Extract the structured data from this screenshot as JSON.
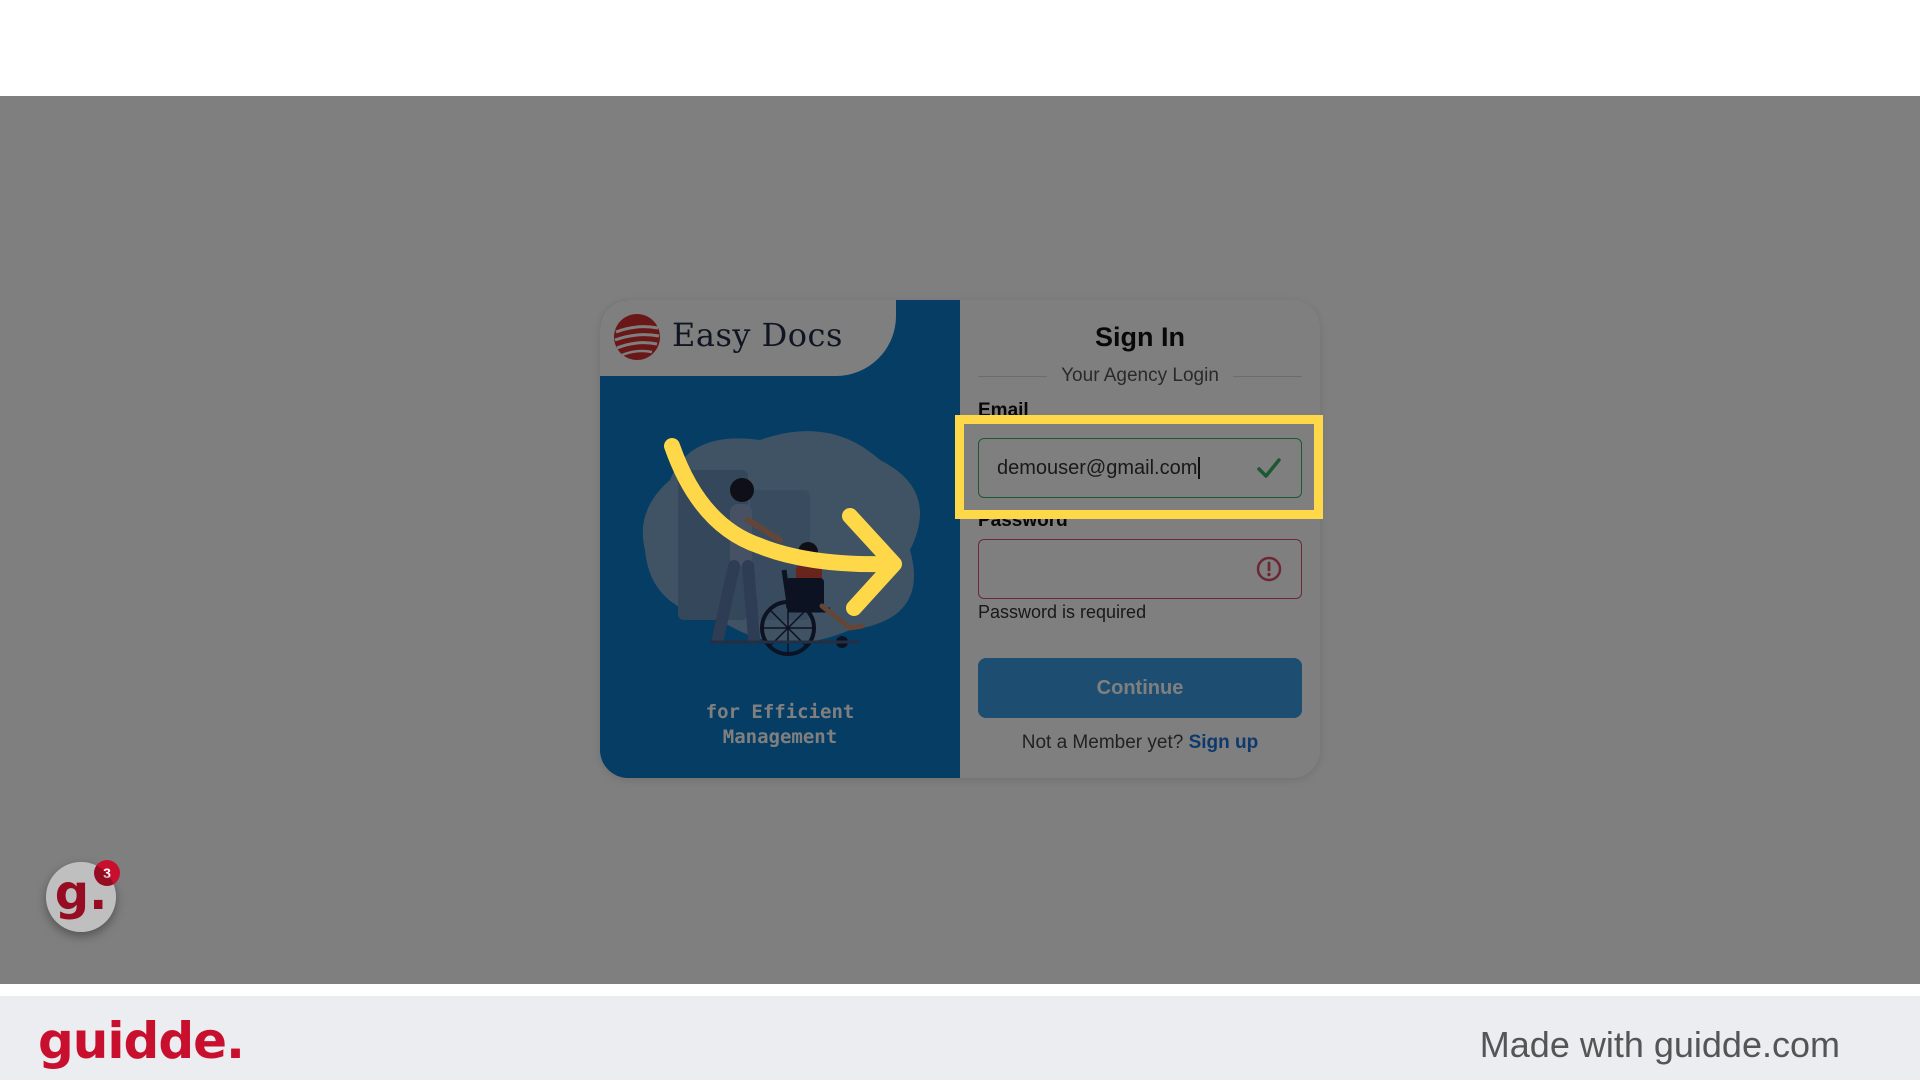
{
  "app": {
    "logo_text": "Easy Docs",
    "tagline_line1": "for Efficient",
    "tagline_line2": "Management",
    "colors": {
      "panel_blue": "#0a7ac9",
      "accent_yellow": "#ffd84a",
      "brand_red": "#c8102e",
      "valid_green": "#39b265",
      "error_red": "#d94f6a"
    }
  },
  "signin": {
    "title": "Sign In",
    "subtitle": "Your Agency Login",
    "email_label": "Email",
    "email_value": "demouser@gmail.com",
    "password_label": "Password",
    "password_value": "",
    "password_error": "Password is required",
    "continue_label": "Continue",
    "member_prompt": "Not a Member yet?",
    "signup_label": "Sign up",
    "email_status_icon": "check-icon",
    "password_status_icon": "error-circle-icon"
  },
  "guide": {
    "bubble_letter": "g.",
    "bubble_badge": "3"
  },
  "footer": {
    "logo": "guidde.",
    "made_with": "Made with guidde.com"
  }
}
